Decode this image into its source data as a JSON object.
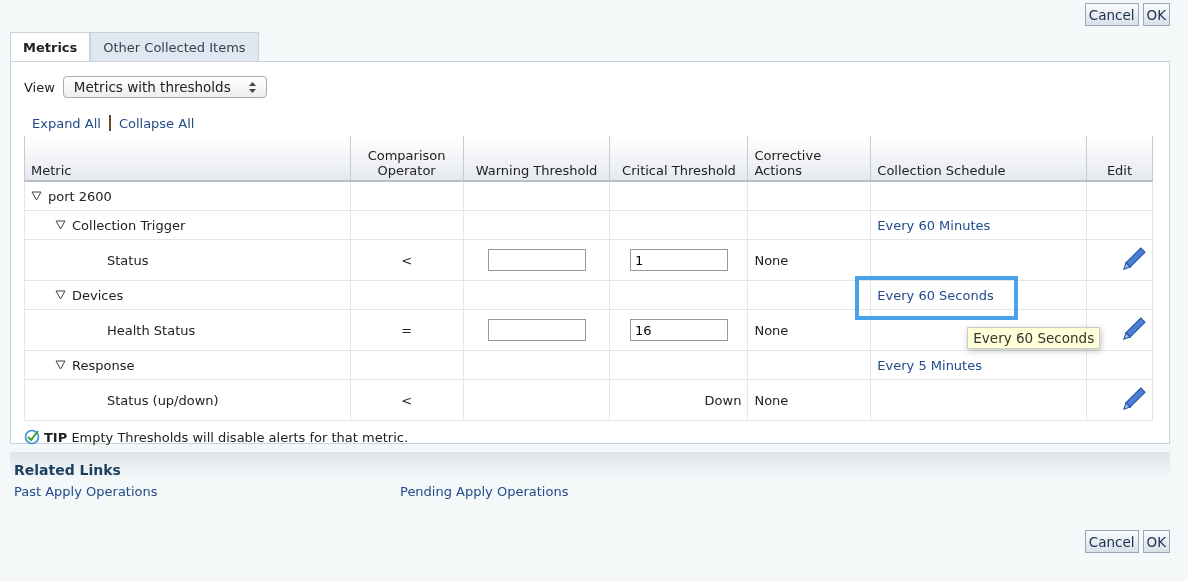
{
  "top_buttons": [
    "Cancel",
    "OK"
  ],
  "tabs": [
    {
      "label": "Metrics",
      "selected": true
    },
    {
      "label": "Other Collected Items",
      "selected": false
    }
  ],
  "view": {
    "label": "View",
    "value": "Metrics with thresholds"
  },
  "tree_links": [
    "Expand All",
    "Collapse All"
  ],
  "table": {
    "columns": [
      "Metric",
      "Comparison Operator",
      "Warning Threshold",
      "Critical Threshold",
      "Corrective Actions",
      "Collection Schedule",
      "Edit"
    ],
    "rows": [
      {
        "name": "port 2600",
        "expanded": true,
        "children": [
          {
            "name": "Collection Trigger",
            "expanded": true,
            "schedule": "Every 60 Minutes",
            "children": [
              {
                "name": "Status",
                "operator": "<",
                "warning": {
                  "kind": "field"
                },
                "critical": {
                  "kind": "field",
                  "value": "1"
                },
                "corrective": "None",
                "edit": true
              }
            ]
          },
          {
            "name": "Devices",
            "expanded": true,
            "schedule": "Every 60 Seconds",
            "highlighted": true,
            "tooltip": "Every 60 Seconds",
            "children": [
              {
                "name": "Health Status",
                "operator": "=",
                "warning": {
                  "kind": "field"
                },
                "critical": {
                  "kind": "field",
                  "value": "16"
                },
                "corrective": "None",
                "edit": true
              }
            ]
          },
          {
            "name": "Response",
            "expanded": true,
            "schedule": "Every 5 Minutes",
            "children": [
              {
                "name": "Status (up/down)",
                "operator": "<",
                "critical": {
                  "kind": "text",
                  "value": "Down"
                },
                "corrective": "None",
                "edit": true
              }
            ]
          }
        ]
      }
    ]
  },
  "tip": {
    "label": "TIP",
    "text": "Empty Thresholds will disable alerts for that metric."
  },
  "related_links": {
    "title": "Related Links",
    "links": [
      "Past Apply Operations",
      "Pending Apply Operations"
    ]
  },
  "bottom_buttons": [
    "Cancel",
    "OK"
  ]
}
